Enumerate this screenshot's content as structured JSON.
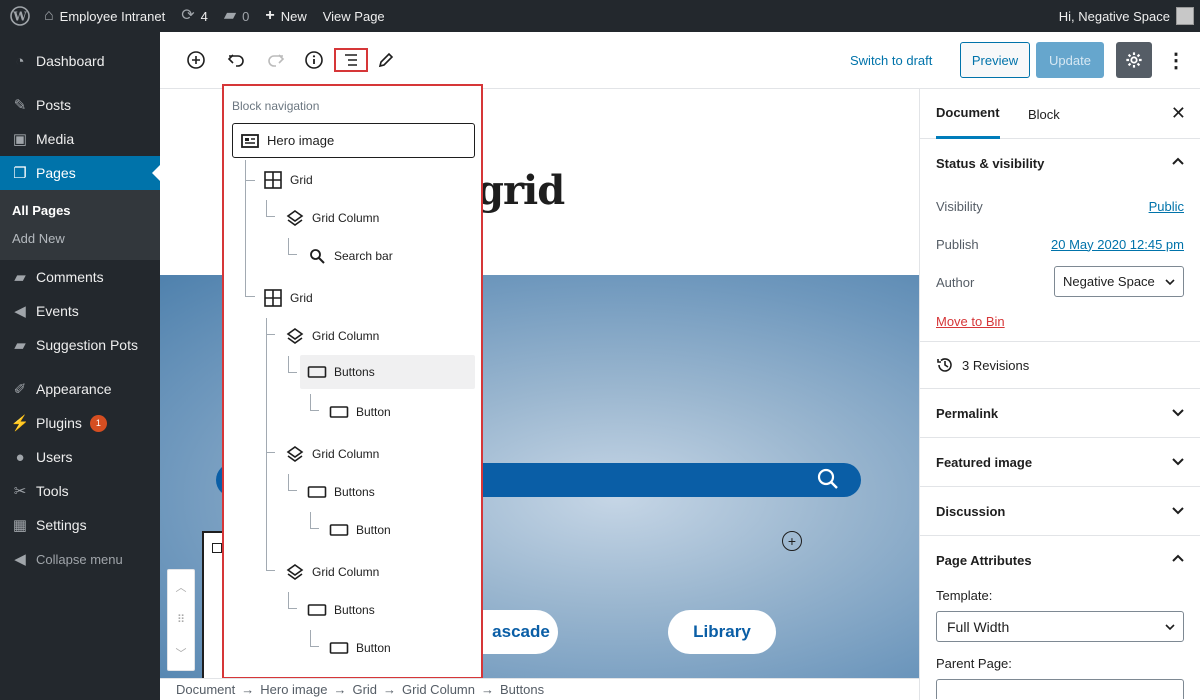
{
  "adminbar": {
    "site_name": "Employee Intranet",
    "updates_count": "4",
    "comments_count": "0",
    "new_label": "New",
    "view_page_label": "View Page",
    "greeting": "Hi, Negative Space"
  },
  "sidebar": {
    "items": [
      {
        "label": "Dashboard",
        "icon": "dashboard-icon"
      },
      {
        "label": "Posts",
        "icon": "pin-icon"
      },
      {
        "label": "Media",
        "icon": "media-icon"
      },
      {
        "label": "Pages",
        "icon": "pages-icon"
      },
      {
        "label": "Comments",
        "icon": "comment-icon"
      },
      {
        "label": "Events",
        "icon": "megaphone-icon"
      },
      {
        "label": "Suggestion Pots",
        "icon": "comment-icon"
      },
      {
        "label": "Appearance",
        "icon": "brush-icon"
      },
      {
        "label": "Plugins",
        "icon": "plug-icon",
        "badge": "1"
      },
      {
        "label": "Users",
        "icon": "user-icon"
      },
      {
        "label": "Tools",
        "icon": "wrench-icon"
      },
      {
        "label": "Settings",
        "icon": "settings-icon"
      },
      {
        "label": "Collapse menu",
        "icon": "collapse-icon"
      }
    ],
    "submenu": [
      "All Pages",
      "Add New"
    ]
  },
  "toolbar": {
    "switch_to_draft": "Switch to draft",
    "preview": "Preview",
    "update": "Update"
  },
  "canvas": {
    "title_fragment": "grid",
    "buttons": [
      "ascade",
      "Library"
    ]
  },
  "block_navigation": {
    "title": "Block navigation",
    "root": "Hero image",
    "items": [
      {
        "label": "Grid",
        "icon": "grid-icon"
      },
      {
        "label": "Grid Column",
        "icon": "stack-icon"
      },
      {
        "label": "Search bar",
        "icon": "search-icon"
      },
      {
        "label": "Grid",
        "icon": "grid-icon"
      },
      {
        "label": "Grid Column",
        "icon": "stack-icon"
      },
      {
        "label": "Buttons",
        "icon": "button-icon"
      },
      {
        "label": "Button",
        "icon": "button-icon"
      },
      {
        "label": "Grid Column",
        "icon": "stack-icon"
      },
      {
        "label": "Buttons",
        "icon": "button-icon"
      },
      {
        "label": "Button",
        "icon": "button-icon"
      },
      {
        "label": "Grid Column",
        "icon": "stack-icon"
      },
      {
        "label": "Buttons",
        "icon": "button-icon"
      },
      {
        "label": "Button",
        "icon": "button-icon"
      }
    ]
  },
  "inspector": {
    "tabs": [
      "Document",
      "Block"
    ],
    "status_visibility": "Status & visibility",
    "visibility_label": "Visibility",
    "visibility_value": "Public",
    "publish_label": "Publish",
    "publish_value": "20 May 2020 12:45 pm",
    "author_label": "Author",
    "author_value": "Negative Space",
    "move_to_bin": "Move to Bin",
    "revisions": "3 Revisions",
    "permalink": "Permalink",
    "featured_image": "Featured image",
    "discussion": "Discussion",
    "page_attributes": "Page Attributes",
    "template_label": "Template:",
    "template_value": "Full Width",
    "parent_page_label": "Parent Page:"
  },
  "breadcrumb": [
    "Document",
    "Hero image",
    "Grid",
    "Grid Column",
    "Buttons"
  ],
  "colors": {
    "admin_dark": "#23282d",
    "accent": "#0073aa",
    "highlight_red": "#d63638",
    "hero_blue": "#0a5ea6"
  }
}
